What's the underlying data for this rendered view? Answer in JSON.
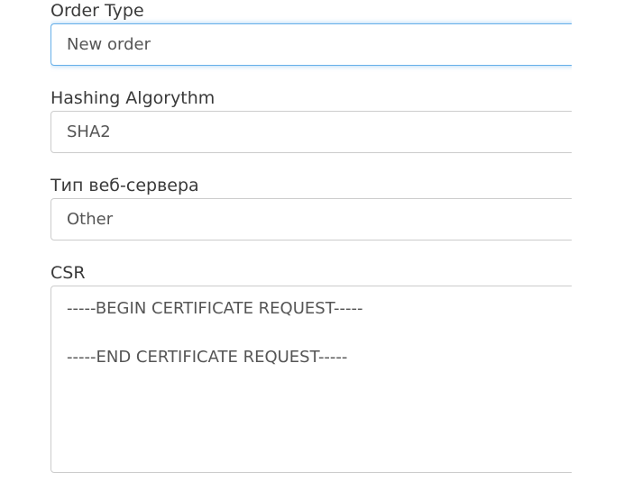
{
  "form": {
    "order_type": {
      "label": "Order Type",
      "value": "New order"
    },
    "hashing_algorithm": {
      "label": "Hashing Algorythm",
      "value": "SHA2"
    },
    "web_server_type": {
      "label": "Тип веб-сервера",
      "value": "Other"
    },
    "csr": {
      "label": "CSR",
      "begin_line": "-----BEGIN CERTIFICATE REQUEST-----",
      "end_line": "-----END CERTIFICATE REQUEST-----"
    }
  },
  "colors": {
    "focus_border": "#66afe9",
    "border": "#cccccc",
    "label_text": "#3a3a3a",
    "value_text": "#555555"
  }
}
